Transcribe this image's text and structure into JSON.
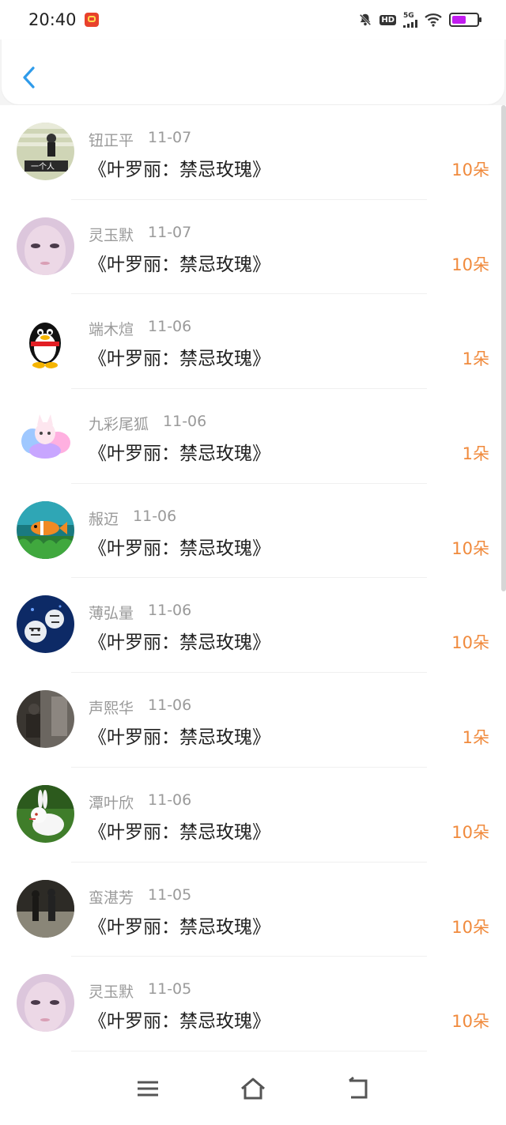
{
  "status_bar": {
    "time": "20:40",
    "network": "5G",
    "hd": "HD",
    "battery_level": 0.55
  },
  "header": {
    "back_icon": "chevron-left-icon"
  },
  "colors": {
    "accent": "#f08a3c",
    "back": "#2f9bea",
    "title": "#222222",
    "meta": "#9a9a9a"
  },
  "items": [
    {
      "name": "钮正平",
      "date": "11-07",
      "title": "《叶罗丽：禁忌玫瑰》",
      "amount": "10朵",
      "avatar": "avatar-boy-photo"
    },
    {
      "name": "灵玉默",
      "date": "11-07",
      "title": "《叶罗丽：禁忌玫瑰》",
      "amount": "10朵",
      "avatar": "avatar-face-pink"
    },
    {
      "name": "端木煊",
      "date": "11-06",
      "title": "《叶罗丽：禁忌玫瑰》",
      "amount": "1朵",
      "avatar": "avatar-qq-penguin"
    },
    {
      "name": "九彩尾狐",
      "date": "11-06",
      "title": "《叶罗丽：禁忌玫瑰》",
      "amount": "1朵",
      "avatar": "avatar-rainbow-fox"
    },
    {
      "name": "赧迈",
      "date": "11-06",
      "title": "《叶罗丽：禁忌玫瑰》",
      "amount": "10朵",
      "avatar": "avatar-clownfish"
    },
    {
      "name": "薄弘量",
      "date": "11-06",
      "title": "《叶罗丽：禁忌玫瑰》",
      "amount": "10朵",
      "avatar": "avatar-white-tigers"
    },
    {
      "name": "声熙华",
      "date": "11-06",
      "title": "《叶罗丽：禁忌玫瑰》",
      "amount": "1朵",
      "avatar": "avatar-dark-photo"
    },
    {
      "name": "潭叶欣",
      "date": "11-06",
      "title": "《叶罗丽：禁忌玫瑰》",
      "amount": "10朵",
      "avatar": "avatar-white-rabbit"
    },
    {
      "name": "蛮湛芳",
      "date": "11-05",
      "title": "《叶罗丽：禁忌玫瑰》",
      "amount": "10朵",
      "avatar": "avatar-street-photo"
    },
    {
      "name": "灵玉默",
      "date": "11-05",
      "title": "《叶罗丽：禁忌玫瑰》",
      "amount": "10朵",
      "avatar": "avatar-face-pink"
    }
  ],
  "nav_bar": {
    "icons": [
      "menu-icon",
      "home-icon",
      "back-icon"
    ]
  }
}
